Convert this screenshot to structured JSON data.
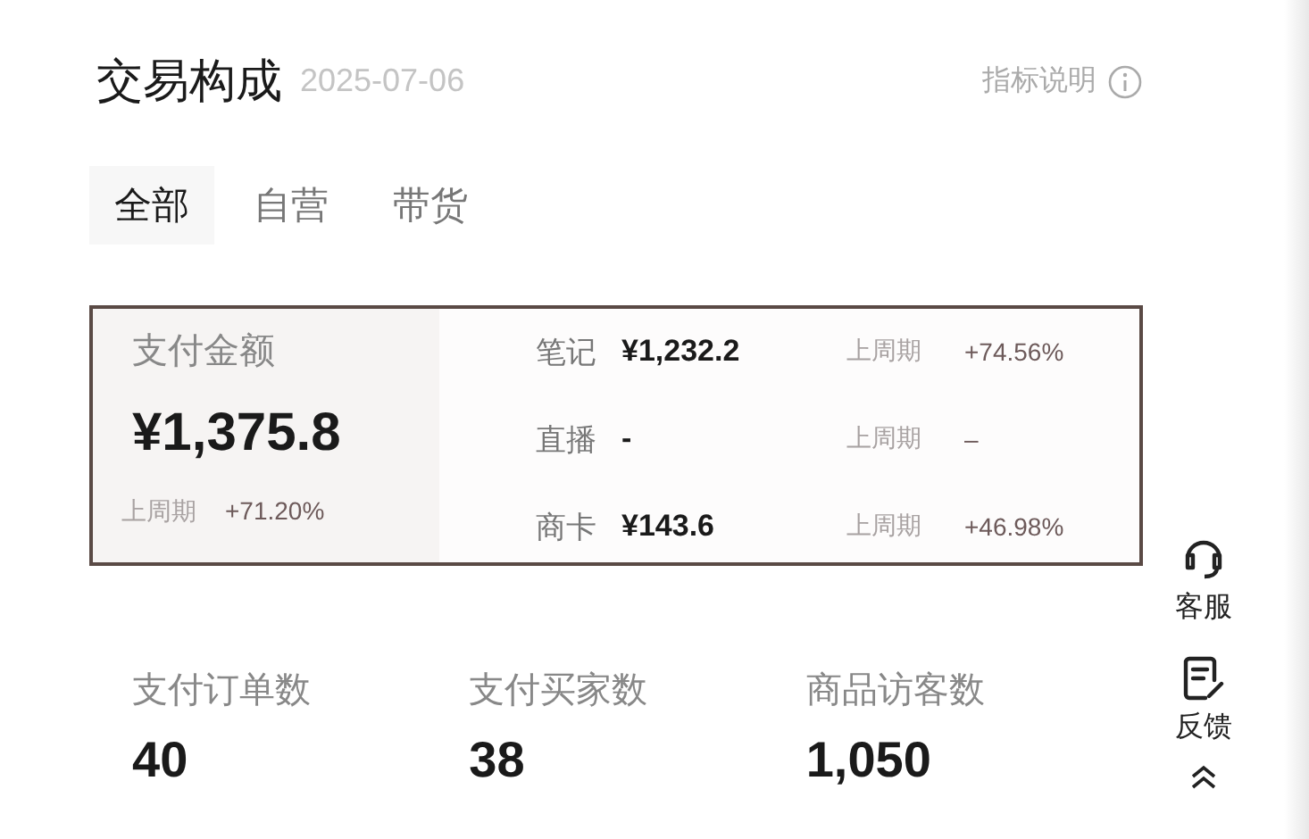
{
  "header": {
    "title": "交易构成",
    "date": "2025-07-06",
    "help_label": "指标说明"
  },
  "tabs": [
    {
      "label": "全部",
      "selected": true
    },
    {
      "label": "自营",
      "selected": false
    },
    {
      "label": "带货",
      "selected": false
    }
  ],
  "payment": {
    "label": "支付金额",
    "value": "¥1,375.8",
    "compare_label": "上周期",
    "change": "+71.20%",
    "channels": [
      {
        "name": "笔记",
        "value": "¥1,232.2",
        "compare_label": "上周期",
        "change": "+74.56%"
      },
      {
        "name": "直播",
        "value": "-",
        "compare_label": "上周期",
        "change": "–"
      },
      {
        "name": "商卡",
        "value": "¥143.6",
        "compare_label": "上周期",
        "change": "+46.98%"
      }
    ]
  },
  "stats": [
    {
      "label": "支付订单数",
      "value": "40"
    },
    {
      "label": "支付买家数",
      "value": "38"
    },
    {
      "label": "商品访客数",
      "value": "1,050"
    }
  ],
  "side_tools": [
    {
      "kind": "service",
      "label": "客服"
    },
    {
      "kind": "feedback",
      "label": "反馈"
    }
  ]
}
